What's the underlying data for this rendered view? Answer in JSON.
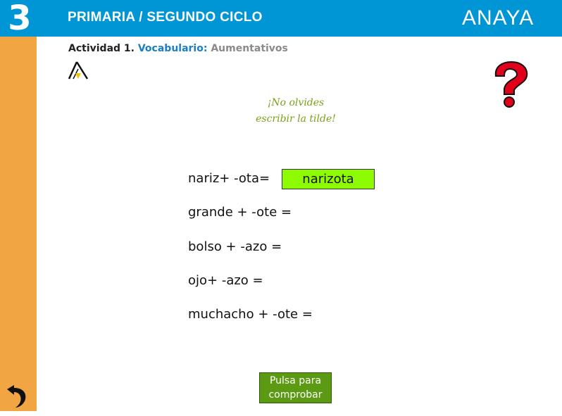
{
  "header": {
    "grade_number": "3",
    "title": "PRIMARIA / SEGUNDO CICLO",
    "brand": "ANAYA"
  },
  "activity": {
    "number_label": "Actividad 1.",
    "category": "Vocabulario:",
    "topic": "Aumentativos"
  },
  "hint": {
    "line1": "¡No olvides",
    "line2": "escribir la tilde!"
  },
  "exercises": [
    {
      "prompt": "nariz+ -ota=",
      "answer": "narizota"
    },
    {
      "prompt": "grande + -ote =",
      "answer": ""
    },
    {
      "prompt": "bolso + -azo =",
      "answer": ""
    },
    {
      "prompt": "ojo+ -azo =",
      "answer": ""
    },
    {
      "prompt": "muchacho + -ote =",
      "answer": ""
    }
  ],
  "check_button": {
    "line1": "Pulsa para",
    "line2": "comprobar"
  },
  "colors": {
    "header_blue": "#0096d6",
    "sidebar_orange": "#f2a643",
    "answer_green": "#8dfc00",
    "button_green": "#5c9a13",
    "hint_green": "#7aa019",
    "help_red": "#e0001b"
  },
  "icons": {
    "back": "back-arrow-icon",
    "help": "question-mark-icon",
    "logo": "anaya-a-logo-icon"
  }
}
